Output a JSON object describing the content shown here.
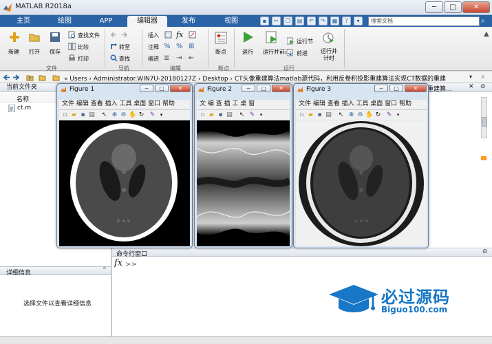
{
  "window": {
    "title": "MATLAB R2018a",
    "minimize_glyph": "─",
    "maximize_glyph": "□",
    "close_glyph": "✕"
  },
  "tabs": [
    {
      "label": "主页"
    },
    {
      "label": "绘图"
    },
    {
      "label": "APP"
    },
    {
      "label": "编辑器",
      "active": true
    },
    {
      "label": "发布"
    },
    {
      "label": "视图"
    }
  ],
  "quick_access": {
    "icons": [
      "save-icon",
      "cut-icon",
      "copy-icon",
      "paste-icon",
      "undo-icon",
      "redo-icon",
      "switch-windows-icon",
      "help-icon"
    ]
  },
  "search": {
    "placeholder": "搜索文档"
  },
  "ribbon": {
    "file_group": {
      "label": "文件",
      "new": "新建",
      "open": "打开",
      "save": "保存",
      "find_files": "查找文件",
      "compare": "比较",
      "print": "打印"
    },
    "nav_group": {
      "label": "导航",
      "goto": "转至",
      "find": "查找"
    },
    "edit_group": {
      "label": "编辑",
      "insert": "插入",
      "comment": "注释",
      "indent": "缩进",
      "fx": "fx"
    },
    "breakpoint_group": {
      "label": "断点",
      "breakpoints": "断点"
    },
    "run_group": {
      "label": "运行",
      "run": "运行",
      "run_advance": "运行并前进",
      "run_section": "运行节",
      "advance": "前进",
      "run_time": "运行并计时"
    }
  },
  "pathbar": {
    "path": "« Users › Administrator.WIN7U-20180127Z › Desktop › CT头像重建算法matlab源代码，利用反卷积投影重建算法实现CT数据的重建"
  },
  "left_panel": {
    "title": "当前文件夹",
    "column_header": "名称",
    "files": [
      {
        "name": "ct.m"
      }
    ],
    "details_title": "详细信息",
    "details_text": "选择文件以查看详细信息"
  },
  "editor_tab_partial": "重建算...",
  "command_window": {
    "title": "命令行窗口",
    "prompt": ">>",
    "fx": "fx"
  },
  "figure_menu": [
    "文件",
    "编辑",
    "查看",
    "插入",
    "工具",
    "桌面",
    "窗口",
    "帮助"
  ],
  "figures": [
    {
      "title": "Figure 1",
      "menu_text": "文件 编辑 查看 插入 工具 桌面 窗口 帮助"
    },
    {
      "title": "Figure 2",
      "menu_text": "文 编 查 插 工 桌 窗"
    },
    {
      "title": "Figure 3",
      "menu_text": "文件 编辑 查看 插入 工具 桌面 窗口 帮助"
    }
  ],
  "watermark": {
    "brand": "必过源码",
    "url": "Biguo100.com"
  },
  "colors": {
    "tab_bar": "#2a63a6",
    "figure_frame": "#d7e4f2",
    "logo_blue": "#1877c6"
  }
}
